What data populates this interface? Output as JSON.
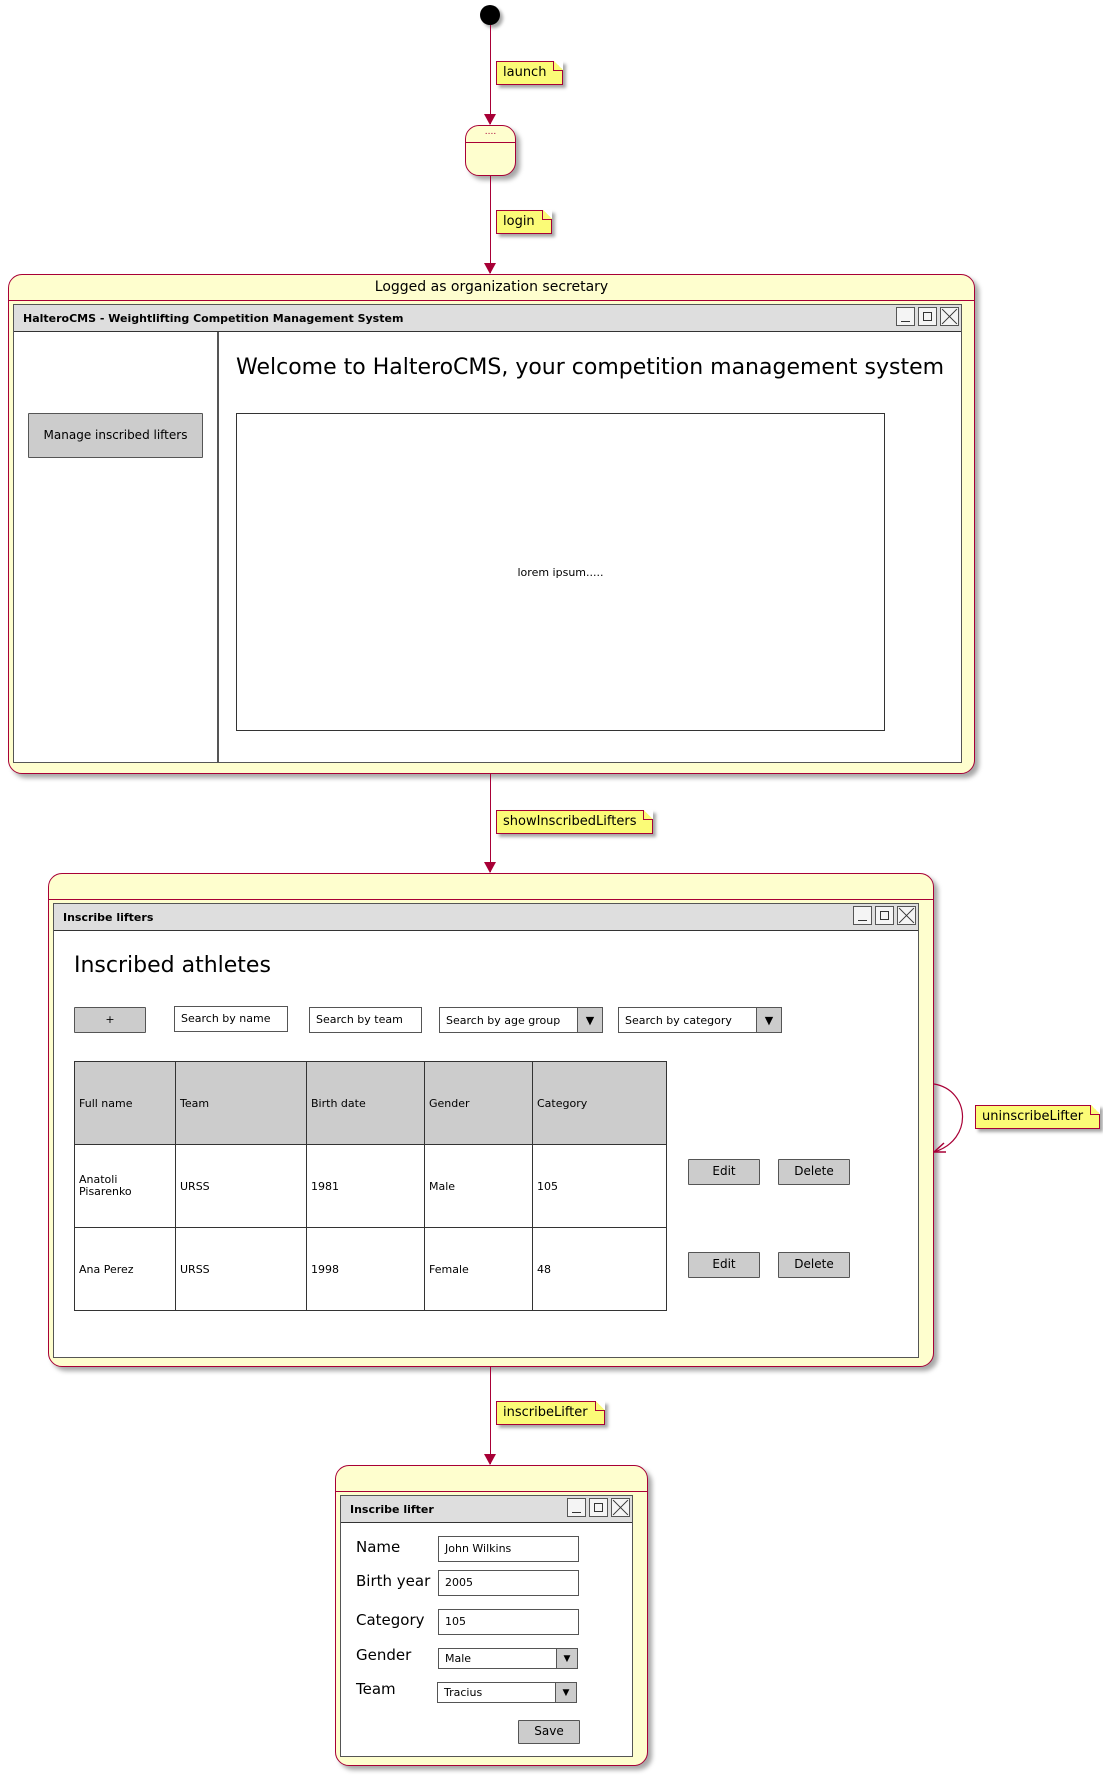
{
  "diagram": {
    "start_node": "initial-state",
    "initial_state_label": "....",
    "transitions": [
      {
        "label": "launch"
      },
      {
        "label": "login"
      },
      {
        "label": "showInscribedLifters"
      },
      {
        "label": "uninscribeLifter"
      },
      {
        "label": "inscribeLifter"
      }
    ],
    "colors": {
      "state_fill": "#fefece",
      "state_border": "#a80036",
      "note_fill": "#fbfb77",
      "button_fill": "#cccccc",
      "titlebar_fill": "#dedede"
    }
  },
  "home_state": {
    "title": "Logged as organization secretary",
    "window": {
      "title": "HalteroCMS - Weightlifting Competition Management System",
      "sidebar_button": "Manage inscribed lifters",
      "heading": "Welcome to HalteroCMS, your competition management system",
      "panel_text": "lorem ipsum....."
    }
  },
  "lifters_state": {
    "title": "",
    "window": {
      "title": "Inscribe lifters",
      "heading": "Inscribed athletes",
      "add_button": "+",
      "search_name": "Search by name",
      "search_team": "Search by team",
      "search_age_group": "Search by age group",
      "search_category": "Search by category",
      "table": {
        "columns": [
          "Full name",
          "Team",
          "Birth date",
          "Gender",
          "Category"
        ],
        "rows": [
          [
            "Anatoli Pisarenko",
            "URSS",
            "1981",
            "Male",
            "105"
          ],
          [
            "Ana Perez",
            "URSS",
            "1998",
            "Female",
            "48"
          ]
        ]
      },
      "edit_label": "Edit",
      "delete_label": "Delete"
    }
  },
  "inscribe_state": {
    "title": "",
    "window": {
      "title": "Inscribe lifter",
      "fields": {
        "name_label": "Name",
        "name_value": "John Wilkins",
        "birth_label": "Birth year",
        "birth_value": "2005",
        "category_label": "Category",
        "category_value": "105",
        "gender_label": "Gender",
        "gender_value": "Male",
        "team_label": "Team",
        "team_value": "Tracius"
      },
      "save_label": "Save"
    }
  },
  "icons": {
    "dropdown": "▼"
  }
}
